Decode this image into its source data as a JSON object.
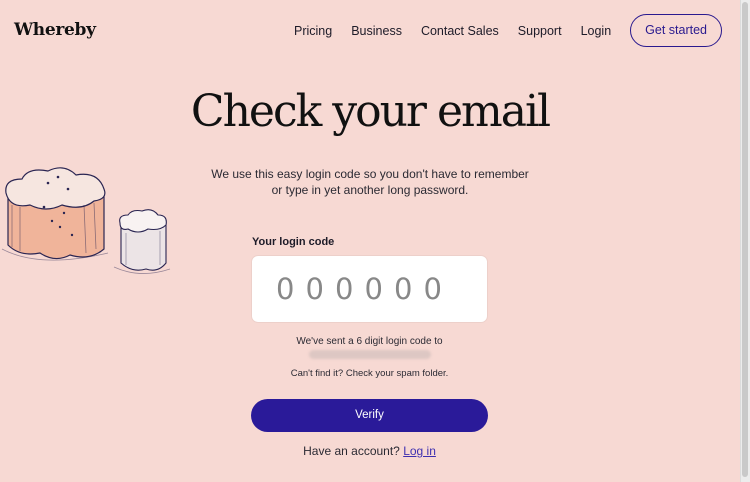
{
  "header": {
    "logo": "Whereby",
    "nav": [
      "Pricing",
      "Business",
      "Contact Sales",
      "Support",
      "Login"
    ],
    "cta": "Get started"
  },
  "main": {
    "title": "Check your email",
    "intro": "We use this easy login code so you don't have to remember or type in yet another long password.",
    "code_label": "Your login code",
    "code_digits": [
      "0",
      "0",
      "0",
      "0",
      "0",
      "0"
    ],
    "sent_text": "We've sent a 6 digit login code to",
    "spam_text": "Can't find it? Check your spam folder.",
    "verify_label": "Verify",
    "account_prompt": "Have an account?",
    "login_link": "Log in"
  },
  "colors": {
    "background": "#f7d9d3",
    "accent": "#2a1a99"
  },
  "icons": [
    "cloud-jar-illustration"
  ]
}
